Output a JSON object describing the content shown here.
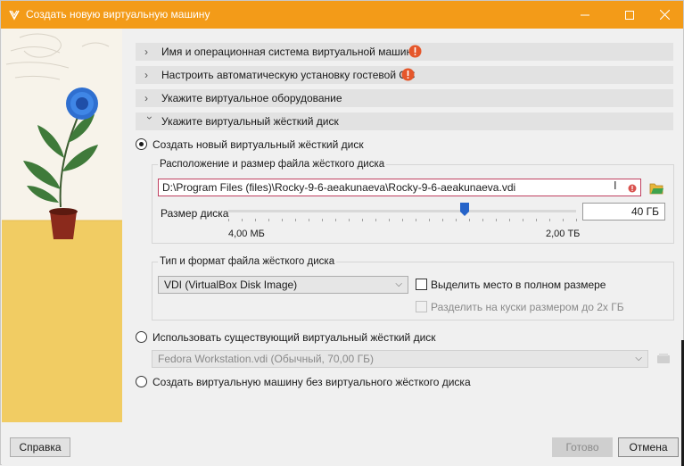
{
  "window": {
    "title": "Создать новую виртуальную машину",
    "accent_color": "#f39b18",
    "controls": {
      "minimize_icon": "minimize-icon",
      "maximize_icon": "maximize-icon",
      "close_icon": "close-icon"
    }
  },
  "sections": [
    {
      "label": "Имя и операционная система виртуальной машины",
      "expanded": false,
      "warning": true
    },
    {
      "label": "Настроить автоматическую установку гостевой ОС",
      "expanded": false,
      "warning": true
    },
    {
      "label": "Укажите виртуальное оборудование",
      "expanded": false,
      "warning": false
    },
    {
      "label": "Укажите виртуальный жёсткий диск",
      "expanded": true,
      "warning": false
    }
  ],
  "disk": {
    "create_new_label": "Создать новый виртуальный жёсткий диск",
    "create_new_selected": true,
    "location_group_title": "Расположение и размер файла жёсткого диска",
    "file_path": "D:\\Program Files (files)\\Rocky-9-6-aeakunaeva\\Rocky-9-6-aeakunaeva.vdi",
    "size_label": "Размер диска",
    "size_value": "40 ГБ",
    "slider_fraction": 0.68,
    "slider_min_label": "4,00 МБ",
    "slider_max_label": "2,00 ТБ",
    "type_group_title": "Тип и формат файла жёсткого диска",
    "format_selected": "VDI (VirtualBox Disk Image)",
    "preallocate_label": "Выделить место в полном размере",
    "preallocate_checked": false,
    "split_label": "Разделить на куски размером до 2х ГБ",
    "split_checked": false,
    "use_existing_label": "Использовать существующий виртуальный жёсткий диск",
    "existing_disk_value": "Fedora Workstation.vdi (Обычный, 70,00 ГБ)",
    "no_disk_label": "Создать виртуальную машину без виртуального жёсткого диска"
  },
  "footer": {
    "help_label": "Справка",
    "finish_label": "Готово",
    "cancel_label": "Отмена"
  }
}
